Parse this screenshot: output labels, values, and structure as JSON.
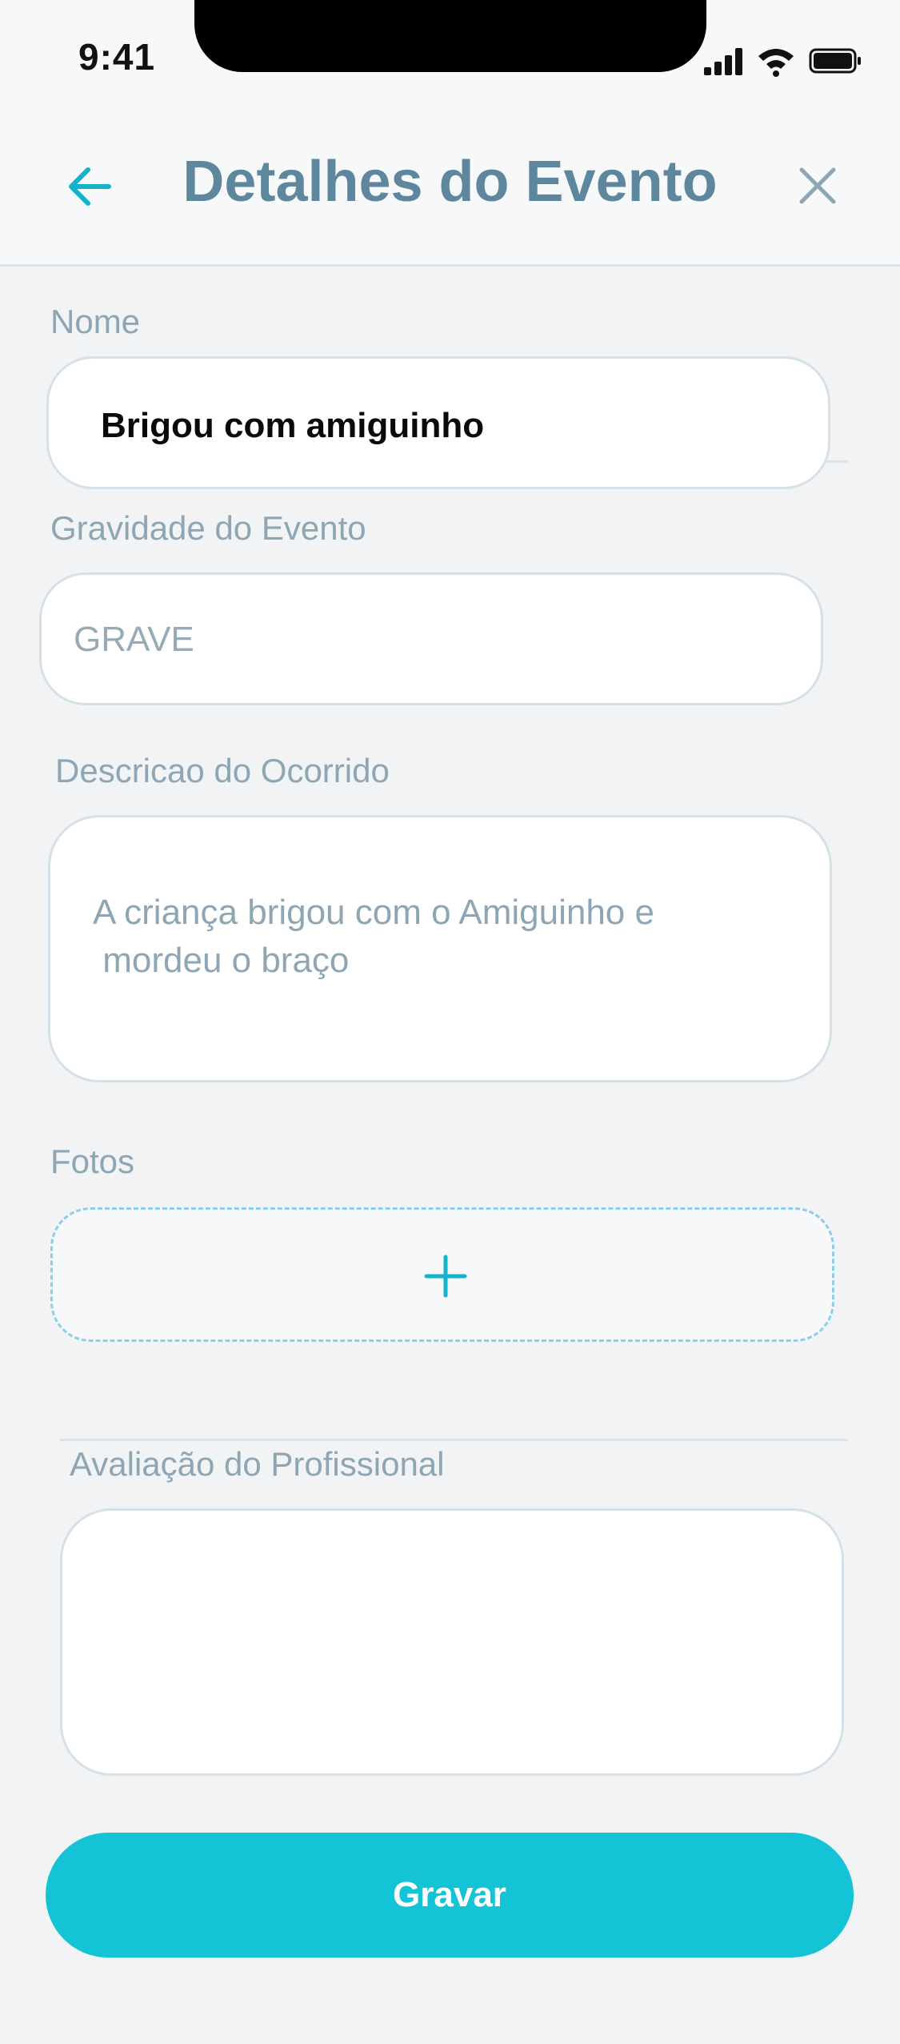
{
  "status_bar": {
    "time": "9:41",
    "icons": [
      "signal-icon",
      "wifi-icon",
      "battery-icon"
    ]
  },
  "header": {
    "title": "Detalhes do Evento",
    "back_icon": "arrow-left-icon",
    "close_icon": "close-icon"
  },
  "form": {
    "name": {
      "label": "Nome",
      "value": "Brigou com amiguinho"
    },
    "severity": {
      "label": "Gravidade do Evento",
      "value": "GRAVE"
    },
    "description": {
      "label": "Descricao do Ocorrido",
      "line1": "A criança brigou com o  Amiguinho e",
      "line2": " mordeu o braço"
    },
    "photos": {
      "label": "Fotos",
      "add_icon": "plus-icon"
    },
    "evaluation": {
      "label": "Avaliação do Profissional",
      "value": ""
    }
  },
  "actions": {
    "save_label": "Gravar"
  },
  "colors": {
    "accent": "#14c3d6",
    "title": "#5e879d",
    "label": "#8ea6b4",
    "background": "#f1f3f5"
  }
}
